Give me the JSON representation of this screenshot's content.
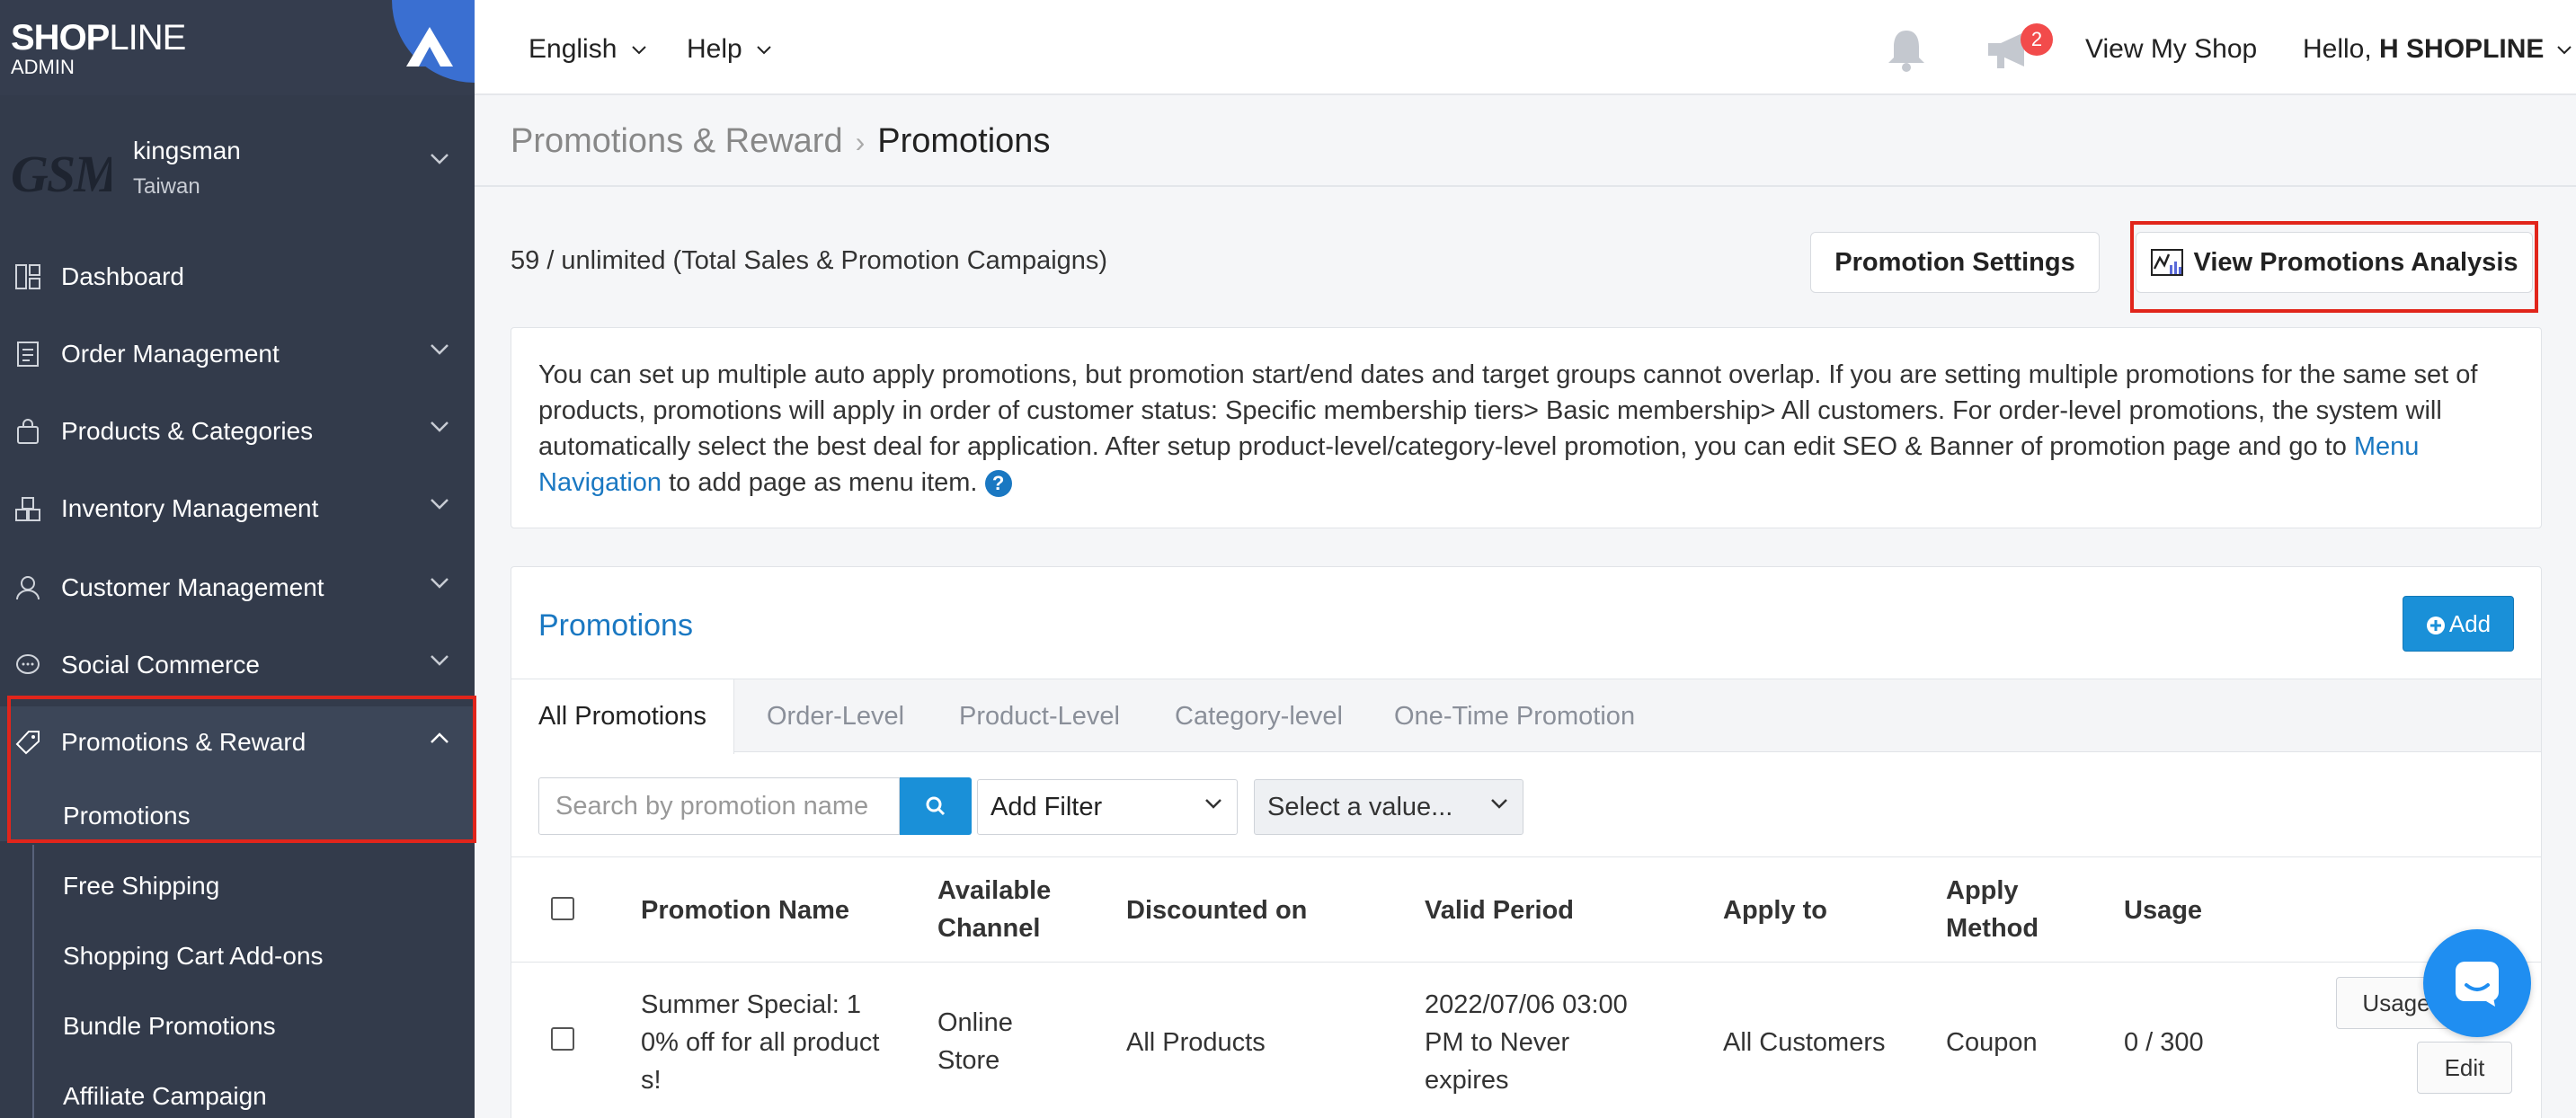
{
  "brand": {
    "logo_bold": "SHOP",
    "logo_thin": "LINE",
    "sub": "ADMIN"
  },
  "store": {
    "logo_text": "GSM",
    "name": "kingsman",
    "region": "Taiwan"
  },
  "sidebar": {
    "items": [
      {
        "label": "Dashboard",
        "icon": "dashboard-icon"
      },
      {
        "label": "Order Management",
        "icon": "order-icon"
      },
      {
        "label": "Products & Categories",
        "icon": "bag-icon"
      },
      {
        "label": "Inventory Management",
        "icon": "inventory-icon"
      },
      {
        "label": "Customer Management",
        "icon": "user-icon"
      },
      {
        "label": "Social Commerce",
        "icon": "chat-icon"
      },
      {
        "label": "Promotions & Reward",
        "icon": "tag-icon"
      }
    ],
    "sub_items": [
      "Promotions",
      "Free Shipping",
      "Shopping Cart Add-ons",
      "Bundle Promotions",
      "Affiliate Campaign"
    ]
  },
  "topbar": {
    "language": "English",
    "help": "Help",
    "notification_count": "2",
    "view_shop": "View My Shop",
    "hello_prefix": "Hello, ",
    "hello_name": "H SHOPLINE"
  },
  "breadcrumb": {
    "parent": "Promotions & Reward",
    "current": "Promotions"
  },
  "summary": {
    "count_text": "59 / unlimited (Total Sales & Promotion Campaigns)"
  },
  "buttons": {
    "settings": "Promotion Settings",
    "analysis": "View Promotions Analysis",
    "add": "Add"
  },
  "notice": {
    "text": "You can set up multiple auto apply promotions, but promotion start/end dates and target groups cannot overlap. If you are setting multiple promotions for the same set of products, promotions will apply in order of customer status: Specific membership tiers> Basic membership> All customers. For order-level promotions, the system will automatically select the best deal for application. After setup product-level/category-level promotion, you can edit SEO & Banner of promotion page and go to ",
    "link": "Menu Navigation",
    "tail": " to add page as menu item."
  },
  "panel": {
    "title": "Promotions",
    "tabs": [
      "All Promotions",
      "Order-Level",
      "Product-Level",
      "Category-level",
      "One-Time Promotion"
    ],
    "search_placeholder": "Search by promotion name",
    "filter": "Add Filter",
    "value_select": "Select a value...",
    "columns": [
      "Promotion Name",
      "Available Channel",
      "Discounted on",
      "Valid Period",
      "Apply to",
      "Apply Method",
      "Usage"
    ],
    "rows": [
      {
        "name": "Summer Special: 10% off for all products!",
        "channel": "Online Store",
        "discounted_on": "All Products",
        "valid_period": "2022/07/06 03:00 PM to Never expires",
        "apply_to": "All Customers",
        "apply_method": "Coupon",
        "usage": "0 / 300",
        "action_usage": "Usage R",
        "action_edit": "Edit"
      }
    ]
  },
  "colors": {
    "accent": "#1a90d8",
    "highlight": "#e1251b",
    "sidebar": "#333b4b"
  }
}
